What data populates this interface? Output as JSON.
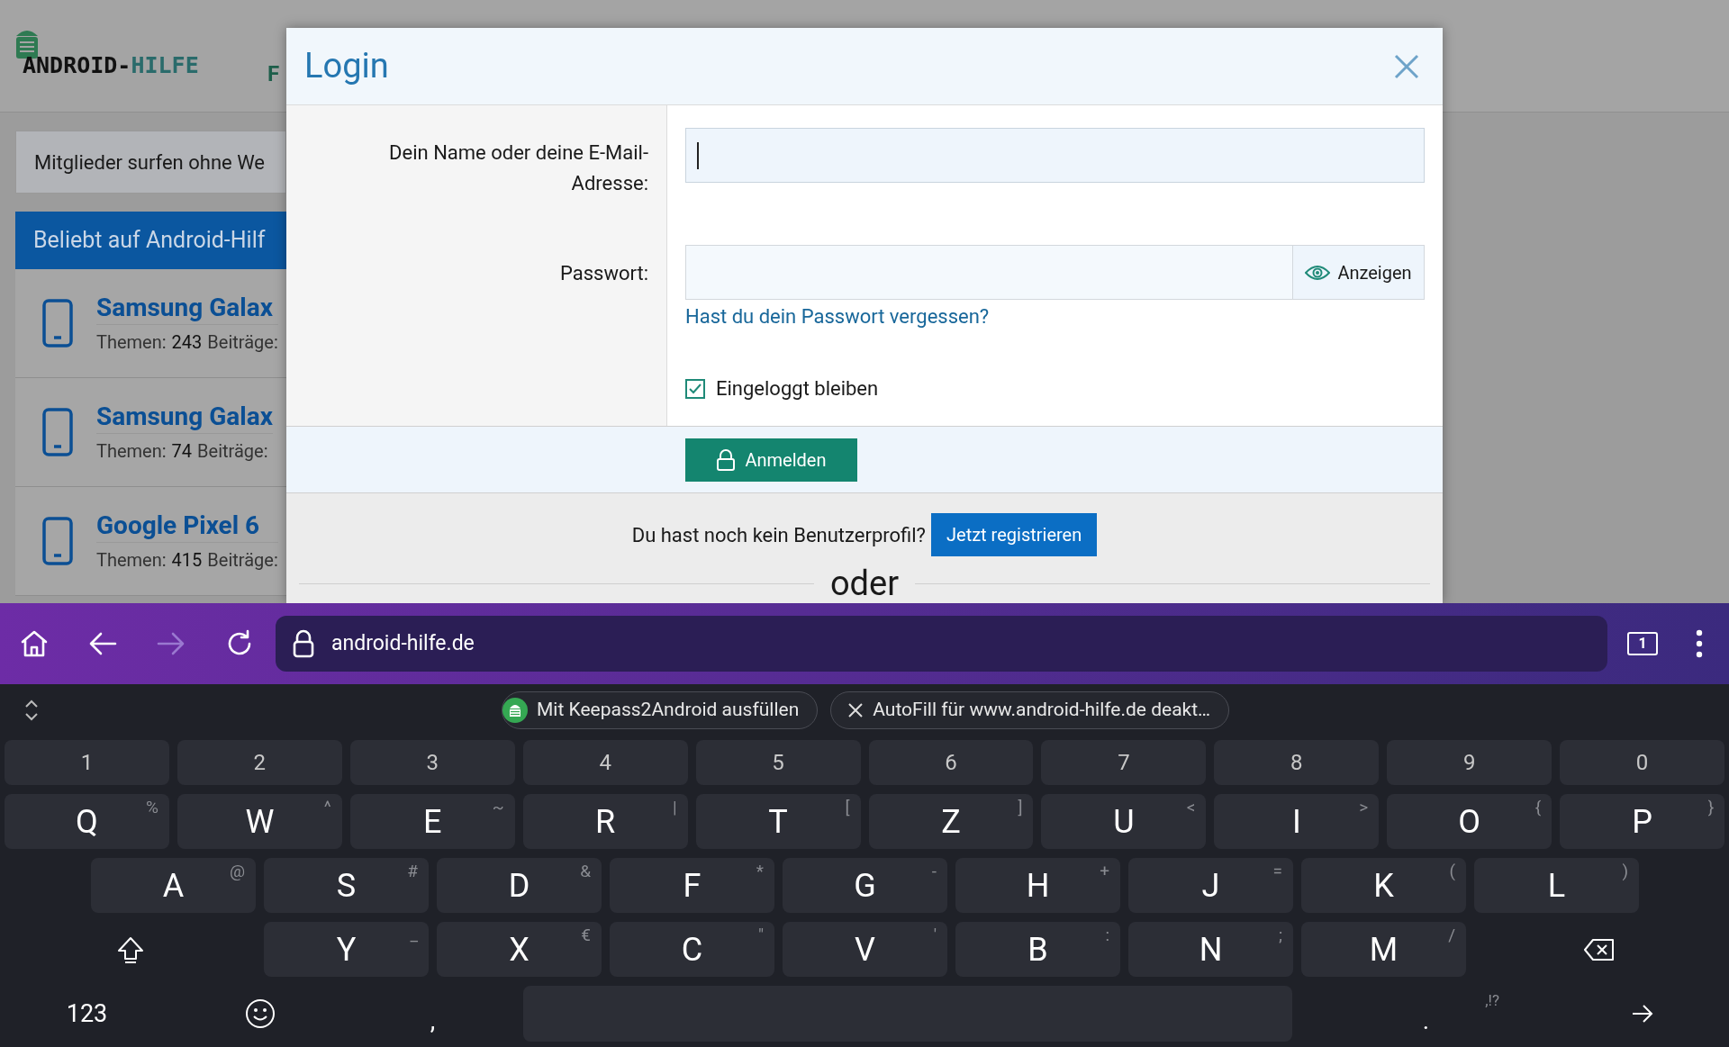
{
  "page": {
    "logo": "ANDROID-HILFE",
    "nav_item": "F",
    "notice": "Mitglieder surfen ohne We",
    "popular": {
      "title": "Beliebt auf Android-Hilf",
      "items": [
        {
          "title": "Samsung Galax",
          "themes_label": "Themen:",
          "themes": "243",
          "posts_label": "Beiträge:"
        },
        {
          "title": "Samsung Galax",
          "themes_label": "Themen:",
          "themes": "74",
          "posts_label": "Beiträge:"
        },
        {
          "title": "Google Pixel 6",
          "themes_label": "Themen:",
          "themes": "415",
          "posts_label": "Beiträge:"
        }
      ]
    }
  },
  "dialog": {
    "title": "Login",
    "name_field": {
      "label": "Dein Name oder deine E-Mail-Adresse:",
      "focused": true
    },
    "password_field": {
      "label": "Passwort:",
      "reveal": "Anzeigen"
    },
    "forgot_link": "Hast du dein Passwort vergessen?",
    "remember": {
      "label": "Eingeloggt bleiben",
      "checked": true
    },
    "submit": "Anmelden",
    "register_prompt": "Du hast noch kein Benutzerprofil?",
    "register_button": "Jetzt registrieren",
    "separator": "oder"
  },
  "browser": {
    "url": "android-hilfe.de",
    "tab_count": "1",
    "forward_disabled": true
  },
  "keyboard": {
    "suggestions": [
      {
        "kind": "app",
        "text": "Mit Keepass2Android ausfüllen"
      },
      {
        "kind": "dismiss",
        "text": "AutoFill für www.android-hilfe.de deakt…"
      }
    ],
    "numbers": [
      "1",
      "2",
      "3",
      "4",
      "5",
      "6",
      "7",
      "8",
      "9",
      "0"
    ],
    "rows": [
      [
        {
          "key": "Q",
          "hint": "%"
        },
        {
          "key": "W",
          "hint": "^"
        },
        {
          "key": "E",
          "hint": "~"
        },
        {
          "key": "R",
          "hint": "|"
        },
        {
          "key": "T",
          "hint": "["
        },
        {
          "key": "Z",
          "hint": "]"
        },
        {
          "key": "U",
          "hint": "<"
        },
        {
          "key": "I",
          "hint": ">"
        },
        {
          "key": "O",
          "hint": "{"
        },
        {
          "key": "P",
          "hint": "}"
        }
      ],
      [
        {
          "key": "A",
          "hint": "@"
        },
        {
          "key": "S",
          "hint": "#"
        },
        {
          "key": "D",
          "hint": "&"
        },
        {
          "key": "F",
          "hint": "*"
        },
        {
          "key": "G",
          "hint": "-"
        },
        {
          "key": "H",
          "hint": "+"
        },
        {
          "key": "J",
          "hint": "="
        },
        {
          "key": "K",
          "hint": "("
        },
        {
          "key": "L",
          "hint": ")"
        }
      ],
      [
        {
          "key": "Y",
          "hint": "_"
        },
        {
          "key": "X",
          "hint": "€"
        },
        {
          "key": "C",
          "hint": "\""
        },
        {
          "key": "V",
          "hint": "'"
        },
        {
          "key": "B",
          "hint": ":"
        },
        {
          "key": "N",
          "hint": ";"
        },
        {
          "key": "M",
          "hint": "/"
        }
      ]
    ],
    "symbols_key": "123",
    "comma": ",",
    "period": ".",
    "period_hint": ",!?"
  }
}
